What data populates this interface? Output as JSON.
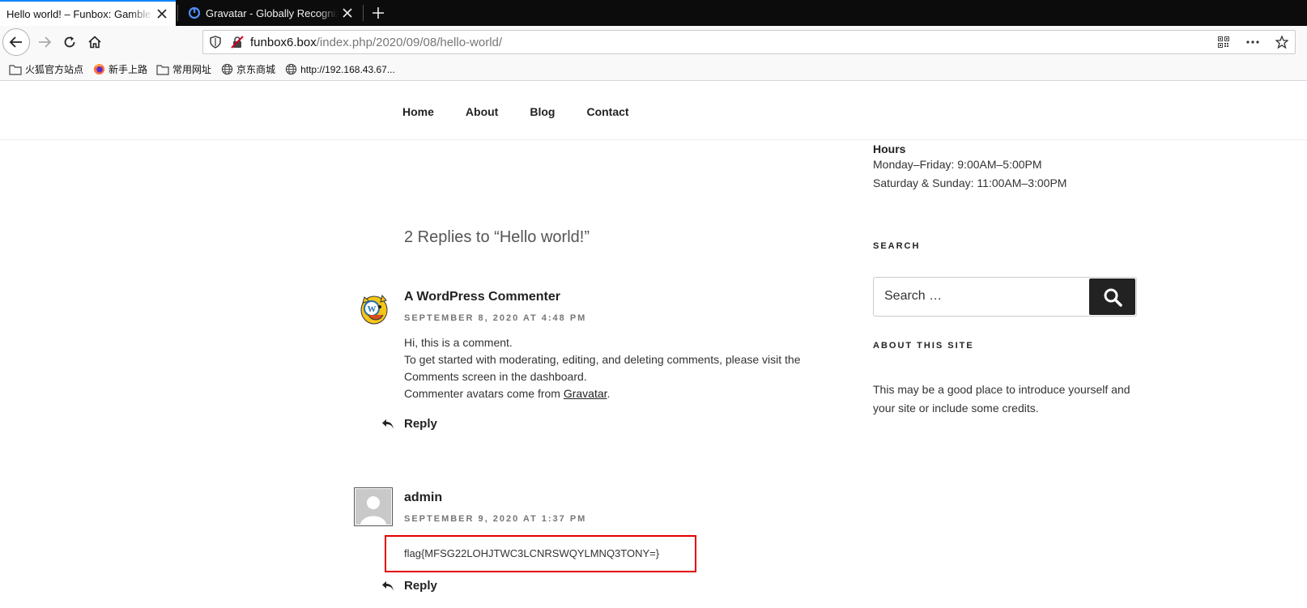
{
  "browser": {
    "tabs": [
      {
        "title": "Hello world! – Funbox: Gamble His Money!",
        "active": true
      },
      {
        "title": "Gravatar - Globally Recognized Avatars",
        "active": false
      }
    ],
    "url": {
      "host": "funbox6.box",
      "path": "/index.php/2020/09/08/hello-world/"
    },
    "bookmarks": [
      {
        "label": "火狐官方站点",
        "icon": "folder-icon"
      },
      {
        "label": "新手上路",
        "icon": "firefox-icon"
      },
      {
        "label": "常用网址",
        "icon": "folder-icon"
      },
      {
        "label": "京东商城",
        "icon": "globe-icon"
      },
      {
        "label": "http://192.168.43.67...",
        "icon": "globe-icon"
      }
    ]
  },
  "site_nav": {
    "items": [
      "Home",
      "About",
      "Blog",
      "Contact"
    ]
  },
  "comments_section": {
    "title": "2 Replies to “Hello world!”",
    "comments": [
      {
        "author": "A WordPress Commenter",
        "date": "SEPTEMBER 8, 2020 AT 4:48 PM",
        "lines": [
          "Hi, this is a comment.",
          "To get started with moderating, editing, and deleting comments, please visit the",
          "Comments screen in the dashboard."
        ],
        "last_line_prefix": "Commenter avatars come from ",
        "last_line_link": "Gravatar",
        "last_line_suffix": ".",
        "reply_label": "Reply"
      },
      {
        "author": "admin",
        "date": "SEPTEMBER 9, 2020 AT 1:37 PM",
        "text": "flag{MFSG22LOHJTWC3LCNRSWQYLMNQ3TONY=}",
        "reply_label": "Reply"
      }
    ]
  },
  "sidebar": {
    "hours_title": "Hours",
    "hours": [
      "Monday–Friday: 9:00AM–5:00PM",
      "Saturday & Sunday: 11:00AM–3:00PM"
    ],
    "search_title": "SEARCH",
    "search_placeholder": "Search …",
    "about_title": "ABOUT THIS SITE",
    "about_text": "This may be a good place to introduce yourself and your site or include some credits."
  },
  "colors": {
    "highlight_box": "#e10000",
    "tab_accent": "#0a84ff",
    "search_button": "#222222"
  }
}
